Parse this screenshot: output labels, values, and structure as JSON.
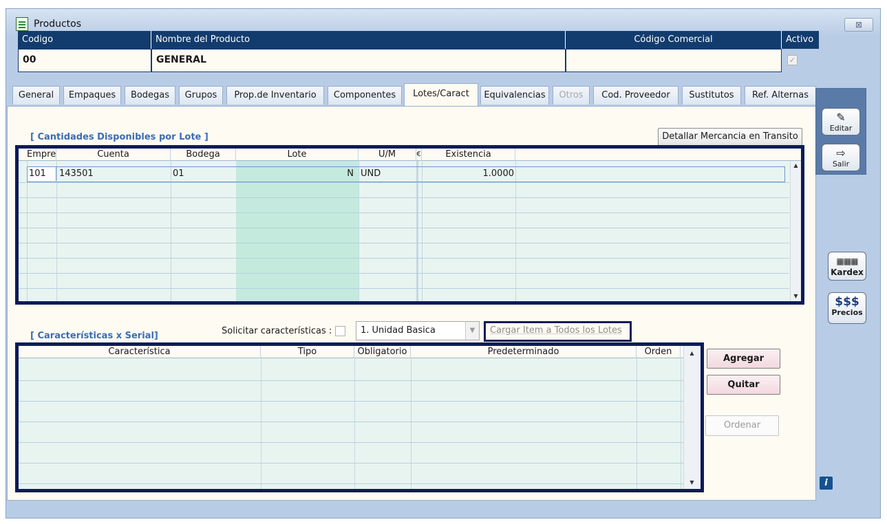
{
  "window": {
    "title": "Productos",
    "close_label": "⊠"
  },
  "product_header": {
    "col_code": "Codigo",
    "col_name": "Nombre del Producto",
    "col_commercial": "Código Comercial",
    "col_active": "Activo",
    "code_value": "00",
    "name_value": "GENERAL",
    "commercial_value": "",
    "active_checked": "✓"
  },
  "tabs": [
    {
      "label": "General"
    },
    {
      "label": "Empaques"
    },
    {
      "label": "Bodegas"
    },
    {
      "label": "Grupos"
    },
    {
      "label": "Prop.de Inventario"
    },
    {
      "label": "Componentes"
    },
    {
      "label": "Lotes/Caract"
    },
    {
      "label": "Equivalencias"
    },
    {
      "label": "Otros"
    },
    {
      "label": "Cod. Proveedor"
    },
    {
      "label": "Sustitutos"
    },
    {
      "label": "Ref. Alternas"
    }
  ],
  "lots": {
    "title": "[  Cantidades Disponibles por Lote ]",
    "transit_button": "Detallar Mercancia en Transito",
    "columns": [
      "Empres",
      "Cuenta",
      "Bodega",
      "Lote",
      "U/M",
      "€",
      "Existencia"
    ],
    "rows": [
      {
        "empresa": "101",
        "cuenta": "143501",
        "bodega": "01",
        "lote": "N",
        "um": "UND",
        "existencia": "1.0000"
      }
    ]
  },
  "characteristics": {
    "title": "[ Características x Serial]",
    "request_label": "Solicitar características :",
    "unit_select": "1. Unidad Basica",
    "load_all_link": "Cargar Item a Todos los Lotes",
    "columns": [
      "Característica",
      "Tipo",
      "Obligatorio",
      "Predeterminado",
      "Orden"
    ],
    "add_button": "Agregar",
    "remove_button": "Quitar",
    "order_button": "Ordenar"
  },
  "toolbar": {
    "edit_label": "Editar",
    "exit_label": "Salir",
    "kardex_label": "Kardex",
    "prices_symbol": "$$$",
    "prices_label": "Precios",
    "info_label": "i"
  }
}
